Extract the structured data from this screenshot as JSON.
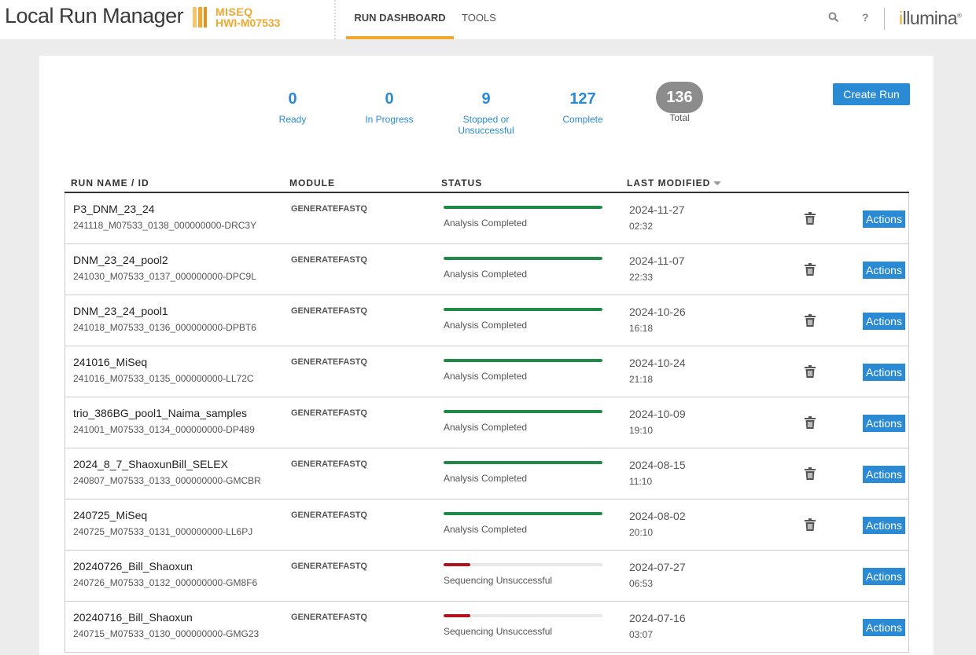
{
  "header": {
    "app_title": "Local Run Manager",
    "instrument_line1": "MISEQ",
    "instrument_line2": "HWI-M07533",
    "tabs": [
      {
        "label": "RUN DASHBOARD",
        "active": true
      },
      {
        "label": "TOOLS",
        "active": false
      }
    ],
    "search_icon": "search-icon",
    "help_label": "?",
    "brand_prefix": "i",
    "brand_rest": "llumina",
    "brand_mark": "®"
  },
  "stats": {
    "ready": {
      "value": "0",
      "label": "Ready"
    },
    "in_progress": {
      "value": "0",
      "label": "In Progress"
    },
    "stopped": {
      "value": "9",
      "label_line1": "Stopped or",
      "label_line2": "Unsuccessful"
    },
    "complete": {
      "value": "127",
      "label": "Complete"
    },
    "total": {
      "value": "136",
      "label": "Total"
    }
  },
  "create_run_label": "Create Run",
  "table": {
    "columns": {
      "name": "RUN NAME / ID",
      "module": "MODULE",
      "status": "STATUS",
      "modified": "LAST MODIFIED"
    },
    "actions_label": "Actions",
    "rows": [
      {
        "name": "P3_DNM_23_24",
        "id": "241118_M07533_0138_000000000-DRC3Y",
        "module": "GENERATEFASTQ",
        "status": "Analysis Completed",
        "progress": 1.0,
        "state": "complete",
        "date": "2024-11-27",
        "time": "02:32",
        "deletable": true
      },
      {
        "name": "DNM_23_24_pool2",
        "id": "241030_M07533_0137_000000000-DPC9L",
        "module": "GENERATEFASTQ",
        "status": "Analysis Completed",
        "progress": 1.0,
        "state": "complete",
        "date": "2024-11-07",
        "time": "22:33",
        "deletable": true
      },
      {
        "name": "DNM_23_24_pool1",
        "id": "241018_M07533_0136_000000000-DPBT6",
        "module": "GENERATEFASTQ",
        "status": "Analysis Completed",
        "progress": 1.0,
        "state": "complete",
        "date": "2024-10-26",
        "time": "16:18",
        "deletable": true
      },
      {
        "name": "241016_MiSeq",
        "id": "241016_M07533_0135_000000000-LL72C",
        "module": "GENERATEFASTQ",
        "status": "Analysis Completed",
        "progress": 1.0,
        "state": "complete",
        "date": "2024-10-24",
        "time": "21:18",
        "deletable": true
      },
      {
        "name": "trio_386BG_pool1_Naima_samples",
        "id": "241001_M07533_0134_000000000-DP489",
        "module": "GENERATEFASTQ",
        "status": "Analysis Completed",
        "progress": 1.0,
        "state": "complete",
        "date": "2024-10-09",
        "time": "19:10",
        "deletable": true
      },
      {
        "name": "2024_8_7_ShaoxunBill_SELEX",
        "id": "240807_M07533_0133_000000000-GMCBR",
        "module": "GENERATEFASTQ",
        "status": "Analysis Completed",
        "progress": 1.0,
        "state": "complete",
        "date": "2024-08-15",
        "time": "11:10",
        "deletable": true
      },
      {
        "name": "240725_MiSeq",
        "id": "240725_M07533_0131_000000000-LL6PJ",
        "module": "GENERATEFASTQ",
        "status": "Analysis Completed",
        "progress": 1.0,
        "state": "complete",
        "date": "2024-08-02",
        "time": "20:10",
        "deletable": true
      },
      {
        "name": "20240726_Bill_Shaoxun",
        "id": "240726_M07533_0132_000000000-GM8F6",
        "module": "GENERATEFASTQ",
        "status": "Sequencing Unsuccessful",
        "progress": 0.17,
        "state": "failed",
        "date": "2024-07-27",
        "time": "06:53",
        "deletable": false
      },
      {
        "name": "20240716_Bill_Shaoxun",
        "id": "240715_M07533_0130_000000000-GMG23",
        "module": "GENERATEFASTQ",
        "status": "Sequencing Unsuccessful",
        "progress": 0.17,
        "state": "failed",
        "date": "2024-07-16",
        "time": "03:07",
        "deletable": false
      }
    ]
  },
  "colors": {
    "accent": "#2a8ad4",
    "orange": "#f0a830",
    "complete": "#1e8a45",
    "failed": "#b3111c"
  }
}
